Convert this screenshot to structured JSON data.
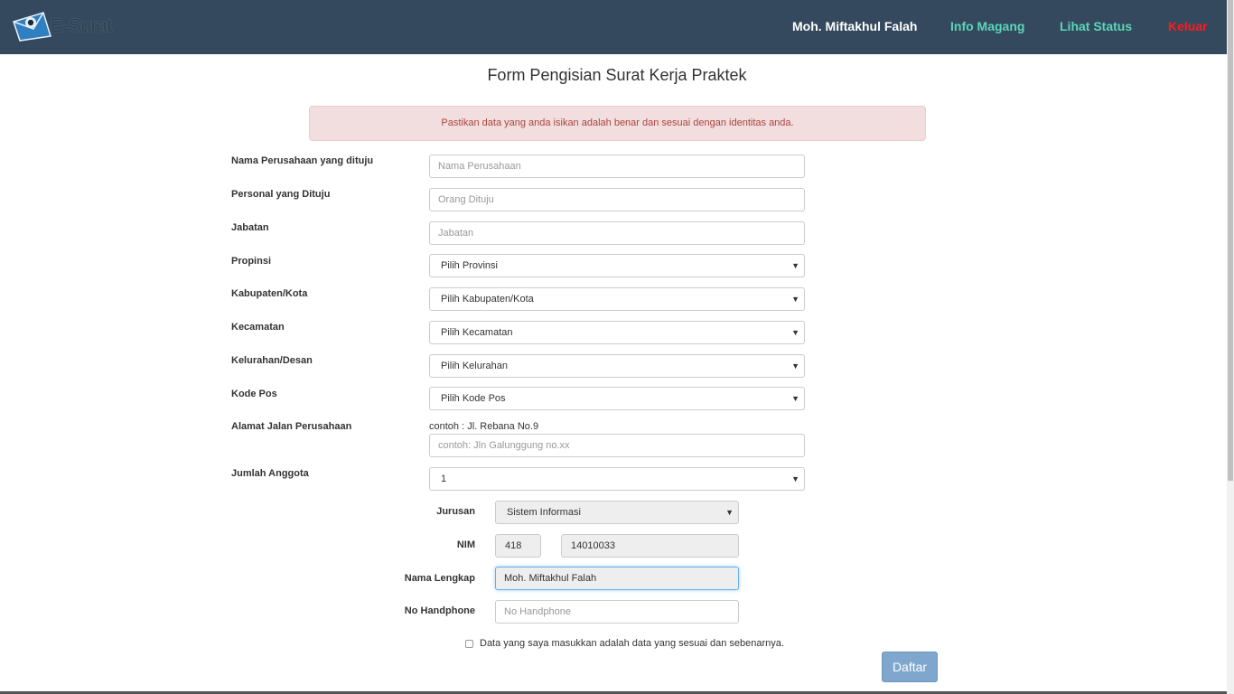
{
  "brand": {
    "text": "E-Surat",
    "accent_color": "#34495e"
  },
  "nav": {
    "user": "Moh. Miftakhul Falah",
    "info_magang": "Info Magang",
    "lihat_status": "Lihat Status",
    "keluar": "Keluar",
    "user_color": "#ffffff",
    "link_color": "#5bd6b8",
    "logout_color": "#ff1a1a"
  },
  "title": "Form Pengisian Surat Kerja Praktek",
  "alert": "Pastikan data yang anda isikan adalah benar dan sesuai dengan identitas anda.",
  "form": {
    "nama_perusahaan": {
      "label": "Nama Perusahaan yang dituju",
      "placeholder": "Nama Perusahaan"
    },
    "personal": {
      "label": "Personal yang Dituju",
      "placeholder": "Orang Dituju"
    },
    "jabatan": {
      "label": "Jabatan",
      "placeholder": "Jabatan"
    },
    "propinsi": {
      "label": "Propinsi",
      "value": "Pilih Provinsi"
    },
    "kabupaten": {
      "label": "Kabupaten/Kota",
      "value": "Pilih Kabupaten/Kota"
    },
    "kecamatan": {
      "label": "Kecamatan",
      "value": "Pilih Kecamatan"
    },
    "kelurahan": {
      "label": "Kelurahan/Desan",
      "value": "Pilih Kelurahan"
    },
    "kode_pos": {
      "label": "Kode Pos",
      "value": "Pilih Kode Pos"
    },
    "alamat": {
      "label": "Alamat Jalan Perusahaan",
      "hint": "contoh : Jl. Rebana No.9",
      "placeholder": "contoh: Jln Galunggung no.xx"
    },
    "jumlah_anggota": {
      "label": "Jumlah Anggota",
      "value": "1"
    }
  },
  "member": {
    "jurusan": {
      "label": "Jurusan",
      "value": "Sistem Informasi"
    },
    "nim": {
      "label": "NIM",
      "prefix": "418",
      "number": "14010033"
    },
    "nama_lengkap": {
      "label": "Nama Lengkap",
      "value": "Moh. Miftakhul Falah"
    },
    "no_handphone": {
      "label": "No Handphone",
      "placeholder": "No Handphone"
    }
  },
  "agreement": "Data yang saya masukkan adalah data yang sesuai dan sebenarnya.",
  "submit": "Daftar"
}
